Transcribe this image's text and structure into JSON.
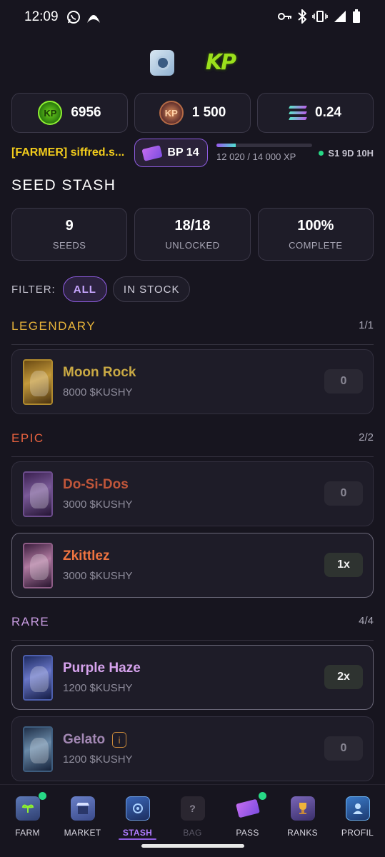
{
  "status_bar": {
    "time": "12:09",
    "icons": [
      "whatsapp-icon",
      "opera-icon",
      "vpn-key-icon",
      "bluetooth-icon",
      "vibrate-icon",
      "signal-icon",
      "battery-icon"
    ]
  },
  "currencies": [
    {
      "icon": "kp-green-coin",
      "value": "6956"
    },
    {
      "icon": "kp-copper-coin",
      "value": "1 500"
    },
    {
      "icon": "solana-icon",
      "value": "0.24"
    }
  ],
  "user": {
    "name": "[FARMER] siffred.s...",
    "bp_label": "BP 14",
    "xp_text": "12 020 / 14 000 XP",
    "xp_progress": 0.2,
    "season": "S1 9D 10H"
  },
  "section_title": "SEED STASH",
  "stats": [
    {
      "value": "9",
      "label": "SEEDS"
    },
    {
      "value": "18/18",
      "label": "UNLOCKED"
    },
    {
      "value": "100%",
      "label": "COMPLETE"
    }
  ],
  "filter": {
    "label": "FILTER:",
    "options": [
      "ALL",
      "IN STOCK"
    ],
    "selected": "ALL"
  },
  "rarities": [
    {
      "name": "LEGENDARY",
      "count": "1/1",
      "color": "#e8b43a"
    },
    {
      "name": "EPIC",
      "count": "2/2",
      "color": "#e8623f"
    },
    {
      "name": "RARE",
      "count": "4/4",
      "color": "#c79be0"
    }
  ],
  "seeds": [
    {
      "name": "Moon Rock",
      "price": "8000 $KUSHY",
      "qty": "0",
      "color": "#c9a944"
    },
    {
      "name": "Do-Si-Dos",
      "price": "3000 $KUSHY",
      "qty": "0",
      "color": "#c0563a"
    },
    {
      "name": "Zkittlez",
      "price": "3000 $KUSHY",
      "qty": "1x",
      "color": "#ef7440"
    },
    {
      "name": "Purple Haze",
      "price": "1200 $KUSHY",
      "qty": "2x",
      "color": "#d5a2ec"
    },
    {
      "name": "Gelato",
      "price": "1200 $KUSHY",
      "qty": "0",
      "color": "#a388b4",
      "badge": "i"
    }
  ],
  "nav": [
    {
      "label": "FARM"
    },
    {
      "label": "MARKET"
    },
    {
      "label": "STASH"
    },
    {
      "label": "BAG"
    },
    {
      "label": "PASS"
    },
    {
      "label": "RANKS"
    },
    {
      "label": "PROFIL"
    }
  ]
}
